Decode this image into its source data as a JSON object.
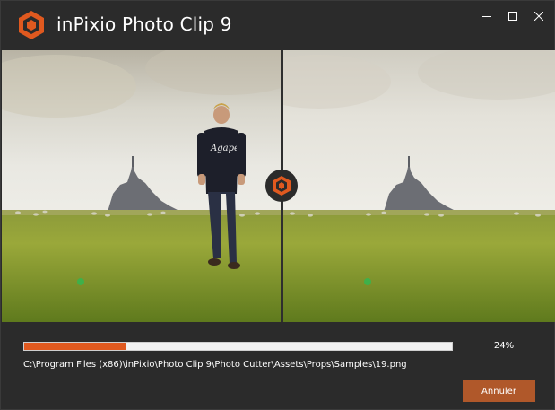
{
  "window": {
    "title": "inPixio Photo Clip 9",
    "controls": {
      "minimize_icon": "minimize-icon",
      "maximize_icon": "maximize-icon",
      "close_icon": "close-icon"
    }
  },
  "viewer": {
    "left_image": "photo-before-with-person",
    "right_image": "photo-after-person-removed",
    "compare_handle_icon": "logo-icon"
  },
  "progress": {
    "value": 0.24,
    "label": "24%",
    "accent_color": "#e0591f"
  },
  "file": {
    "path": "C:\\Program Files (x86)\\inPixio\\Photo Clip 9\\Photo Cutter\\Assets\\Props\\Samples\\19.png"
  },
  "actions": {
    "cancel_label": "Annuler",
    "cancel_color": "#b0582a"
  }
}
